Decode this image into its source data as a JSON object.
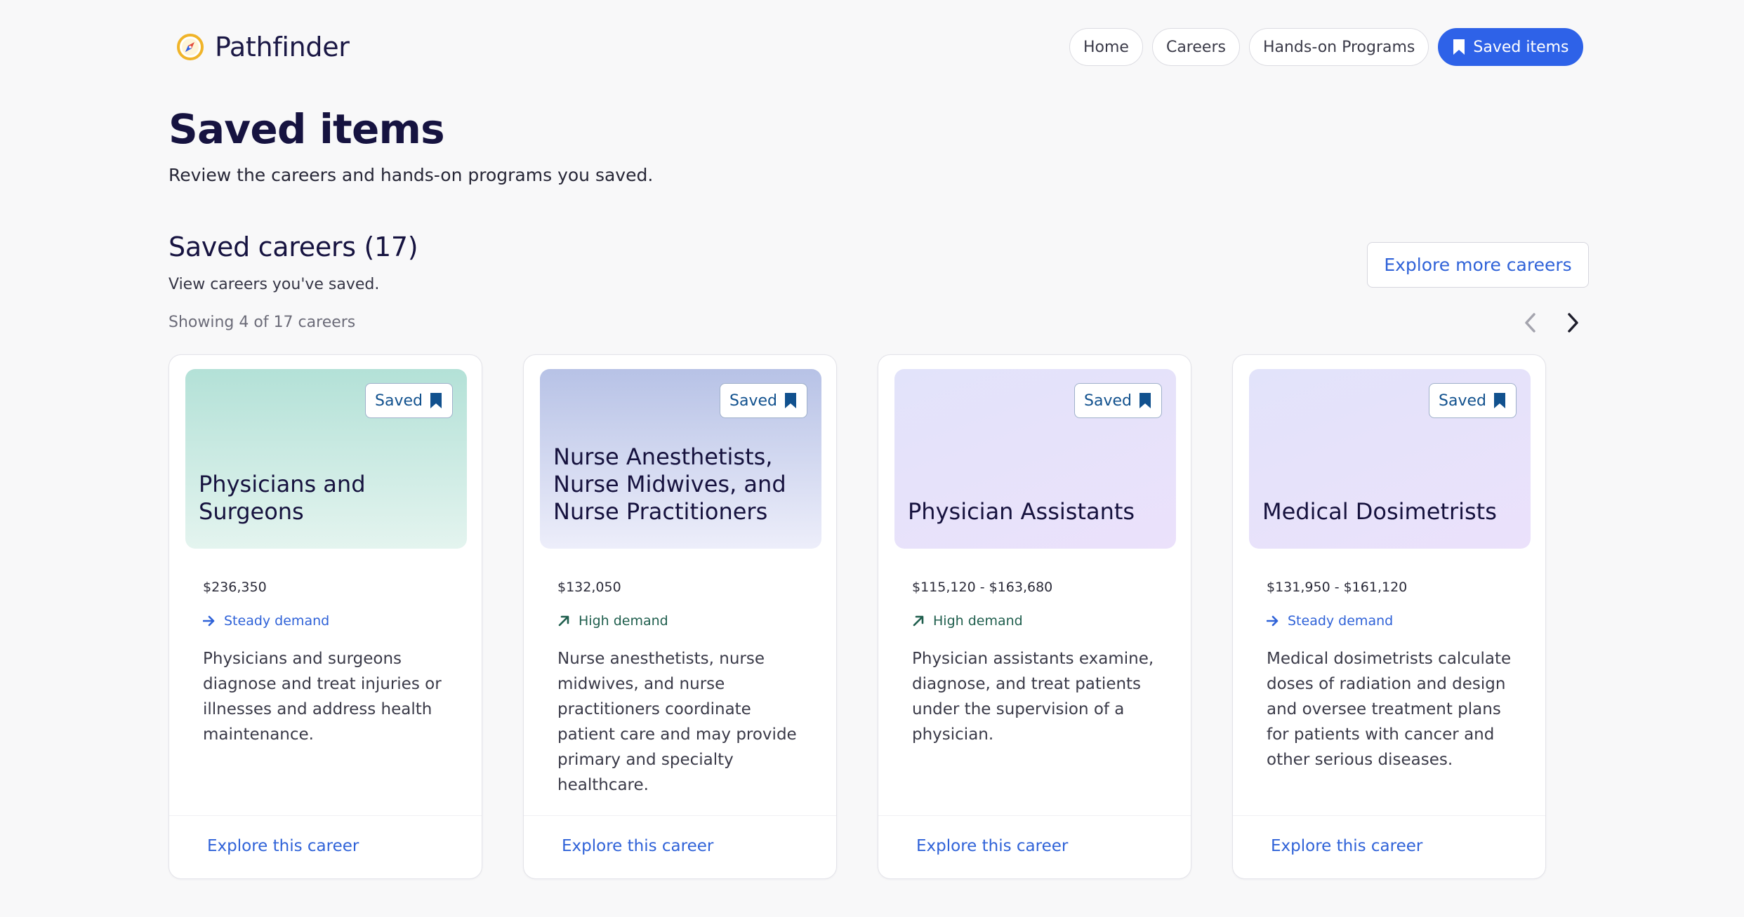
{
  "app": {
    "name": "Pathfinder"
  },
  "nav": {
    "items": [
      {
        "label": "Home"
      },
      {
        "label": "Careers"
      },
      {
        "label": "Hands-on Programs"
      },
      {
        "label": "Saved items"
      }
    ],
    "active": "Saved items"
  },
  "page": {
    "title": "Saved items",
    "subtitle": "Review the careers and hands-on programs you saved."
  },
  "saved_careers": {
    "title": "Saved careers (17)",
    "subtitle": "View careers you've saved.",
    "showing": "Showing 4 of 17 careers",
    "explore_more_label": "Explore more careers",
    "cards": [
      {
        "title": "Physicians and Surgeons",
        "saved_label": "Saved",
        "salary": "$236,350",
        "demand": "Steady demand",
        "demand_type": "steady",
        "description": "Physicians and surgeons diagnose and treat injuries or illnesses and address health maintenance.",
        "link_label": "Explore this career"
      },
      {
        "title": "Nurse Anesthetists, Nurse Midwives, and Nurse Practitioners",
        "saved_label": "Saved",
        "salary": "$132,050",
        "demand": "High demand",
        "demand_type": "high",
        "description": "Nurse anesthetists, nurse midwives, and nurse practitioners coordinate patient care and may provide primary and specialty healthcare.",
        "link_label": "Explore this career"
      },
      {
        "title": "Physician Assistants",
        "saved_label": "Saved",
        "salary": "$115,120 - $163,680",
        "demand": "High demand",
        "demand_type": "high",
        "description": "Physician assistants examine, diagnose, and treat patients under the supervision of a physician.",
        "link_label": "Explore this career"
      },
      {
        "title": "Medical Dosimetrists",
        "saved_label": "Saved",
        "salary": "$131,950 - $161,120",
        "demand": "Steady demand",
        "demand_type": "steady",
        "description": "Medical dosimetrists calculate doses of radiation and design and oversee treatment plans for patients with cancer and other serious diseases.",
        "link_label": "Explore this career"
      }
    ]
  },
  "colors": {
    "accent": "#2e62e8",
    "link": "#2f62d8",
    "heading": "#161340",
    "high_demand": "#1f5e4d"
  },
  "icons": {
    "brand": "compass-icon",
    "saved": "bookmark-icon",
    "steady": "arrow-right-icon",
    "high": "arrow-up-right-icon",
    "prev": "chevron-left-icon",
    "next": "chevron-right-icon"
  }
}
